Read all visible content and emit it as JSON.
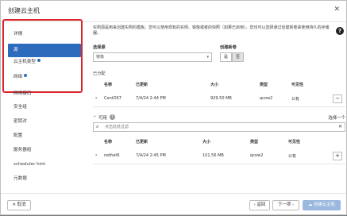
{
  "dialog": {
    "title": "创建云主机",
    "close_glyph": "✕"
  },
  "nav": [
    {
      "label": "详情",
      "required": false
    },
    {
      "label": "源",
      "required": false,
      "active": true
    },
    {
      "label": "云主机类型",
      "required": true
    },
    {
      "label": "网络",
      "required": true
    },
    {
      "label": "网络接口",
      "required": false
    },
    {
      "label": "安全组",
      "required": false
    },
    {
      "label": "密钥对",
      "required": false
    },
    {
      "label": "配置",
      "required": false
    },
    {
      "label": "服务器组",
      "required": false
    },
    {
      "label": "scheduler hint",
      "required": false
    },
    {
      "label": "元数据",
      "required": false
    }
  ],
  "source": {
    "description": "实例源是用来创建实例的模板。您可以使用现有的实例、镜像或者的快照（如果已启用）。您也可以选择通过创建新卷来使用持久的存储器。",
    "help_glyph": "?",
    "select_label": "选择源",
    "select_value": "镜像",
    "create_volume_label": "创建新卷",
    "toggle_yes": "是",
    "toggle_no": "否",
    "allocated_label": "已分配"
  },
  "table_columns": {
    "name": "名称",
    "updated": "已更新",
    "size": "大小",
    "type": "类型",
    "visibility": "可见性"
  },
  "allocated_rows": [
    {
      "name": "CentOS7",
      "updated": "7/4/24 2:44 PM",
      "size": "929.50 MB",
      "type": "qcow2",
      "visibility": "公有",
      "action": "−"
    }
  ],
  "available": {
    "label": "可用",
    "count": "1",
    "choose_one": "选择一个",
    "search_placeholder": "点击此处过滤",
    "search_icon": "search-icon",
    "clear_glyph": "✕",
    "rows": [
      {
        "name": "redhat6",
        "updated": "7/4/24 2:45 PM",
        "size": "101.56 MB",
        "type": "qcow2",
        "visibility": "公有",
        "action": "+"
      }
    ]
  },
  "footer": {
    "cancel": "✕ 取消",
    "back": "‹ 返回",
    "next": "下一项 ›",
    "launch": "☁ 创建云主机"
  },
  "colors": {
    "accent": "#2d6bbd",
    "highlight_border": "#d8242a",
    "primary_disabled": "#9bb8de"
  }
}
